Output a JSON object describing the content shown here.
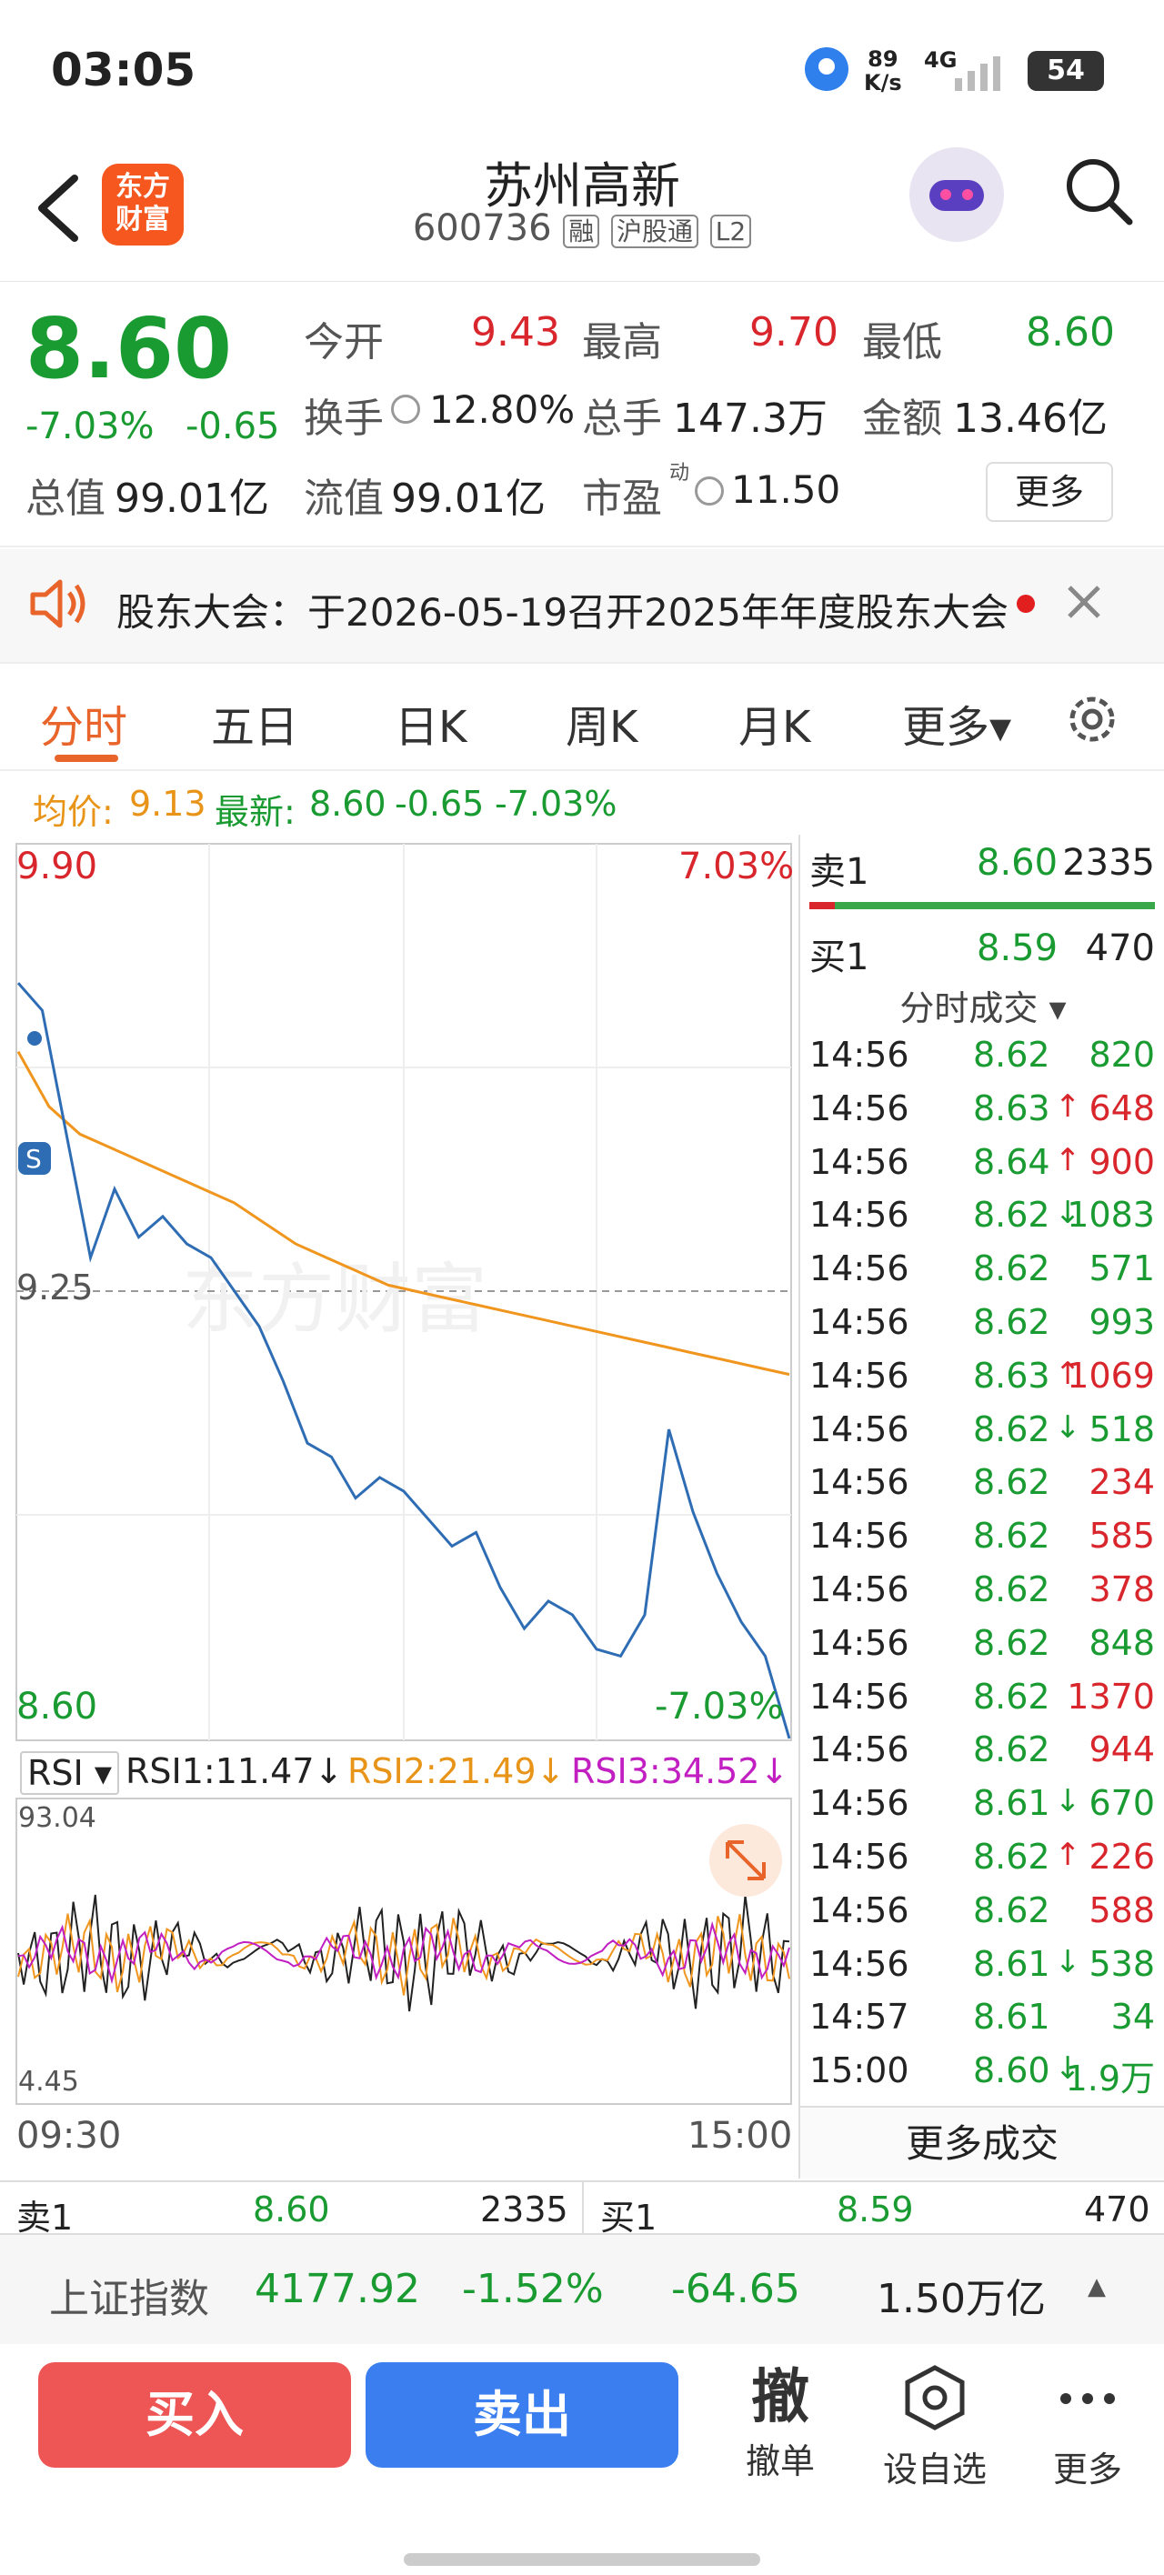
{
  "status": {
    "time": "03:05",
    "net_speed_top": "89",
    "net_speed_bottom": "K/s",
    "signal": "4G",
    "battery": "54"
  },
  "header": {
    "logo_line1": "东方",
    "logo_line2": "财富",
    "title": "苏州高新",
    "code": "600736",
    "tag1": "融",
    "tag2": "沪股通",
    "tag3": "L2"
  },
  "quote": {
    "price": "8.60",
    "change_pct": "-7.03%",
    "change_amt": "-0.65",
    "open_label": "今开",
    "open": "9.43",
    "high_label": "最高",
    "high": "9.70",
    "low_label": "最低",
    "low": "8.60",
    "turnover_label": "换手",
    "turnover": "12.80%",
    "volume_label": "总手",
    "volume": "147.3万",
    "amount_label": "金额",
    "amount": "13.46亿",
    "mktcap_label": "总值",
    "mktcap": "99.01亿",
    "float_label": "流值",
    "float": "99.01亿",
    "pe_label": "市盈",
    "pe_sup": "动",
    "pe": "11.50",
    "more_button": "更多"
  },
  "notice": {
    "text": "股东大会：于2026-05-19召开2025年年度股东大会"
  },
  "tabs": [
    "分时",
    "五日",
    "日K",
    "周K",
    "月K",
    "更多▾"
  ],
  "avg_line": {
    "avg_label": "均价:",
    "avg": "9.13",
    "latest_label": "最新:",
    "latest": "8.60",
    "chg": "-0.65",
    "pct": "-7.03%"
  },
  "chart": {
    "y_top": "9.90",
    "y_mid": "9.25",
    "y_bottom": "8.60",
    "pct_top": "7.03%",
    "pct_bottom": "-7.03%",
    "watermark": "东方财富",
    "s_marker": "S",
    "rsi_selector": "RSI",
    "rsi1": "RSI1:11.47↓",
    "rsi2": "RSI2:21.49↓",
    "rsi3": "RSI3:34.52↓",
    "rsi_top": "93.04",
    "rsi_bottom": "4.45",
    "time_start": "09:30",
    "time_end": "15:00",
    "price_color": "#2e6db4",
    "avg_color": "#f0961e"
  },
  "chart_data": {
    "type": "line",
    "x_range": [
      "09:30",
      "15:00"
    ],
    "ylim": [
      8.6,
      9.9
    ],
    "series": [
      {
        "values": [
          9.7,
          9.66,
          9.48,
          9.3,
          9.4,
          9.33,
          9.36,
          9.32,
          9.3,
          9.25,
          9.2,
          9.12,
          9.03,
          9.01,
          8.95,
          8.98,
          8.96,
          8.92,
          8.88,
          8.9,
          8.82,
          8.76,
          8.8,
          8.78,
          8.73,
          8.72,
          8.78,
          9.05,
          8.93,
          8.84,
          8.77,
          8.72,
          8.6
        ]
      },
      {
        "values": [
          9.6,
          9.52,
          9.48,
          9.46,
          9.44,
          9.42,
          9.4,
          9.38,
          9.35,
          9.32,
          9.3,
          9.28,
          9.26,
          9.25,
          9.24,
          9.23,
          9.22,
          9.21,
          9.2,
          9.19,
          9.18,
          9.17,
          9.16,
          9.15,
          9.14,
          9.13
        ]
      }
    ]
  },
  "orderbook": {
    "sell_label": "卖1",
    "sell_price": "8.60",
    "sell_vol": "2335",
    "buy_label": "买1",
    "buy_price": "8.59",
    "buy_vol": "470"
  },
  "ticks_header": "分时成交 ▾",
  "ticks": [
    {
      "t": "14:56",
      "p": "8.62",
      "a": "",
      "v": "820",
      "c": "g"
    },
    {
      "t": "14:56",
      "p": "8.63",
      "a": "↑",
      "v": "648",
      "c": "r"
    },
    {
      "t": "14:56",
      "p": "8.64",
      "a": "↑",
      "v": "900",
      "c": "r"
    },
    {
      "t": "14:56",
      "p": "8.62",
      "a": "↓",
      "v": "1083",
      "c": "g"
    },
    {
      "t": "14:56",
      "p": "8.62",
      "a": "",
      "v": "571",
      "c": "g"
    },
    {
      "t": "14:56",
      "p": "8.62",
      "a": "",
      "v": "993",
      "c": "g"
    },
    {
      "t": "14:56",
      "p": "8.63",
      "a": "↑",
      "v": "1069",
      "c": "r"
    },
    {
      "t": "14:56",
      "p": "8.62",
      "a": "↓",
      "v": "518",
      "c": "g"
    },
    {
      "t": "14:56",
      "p": "8.62",
      "a": "",
      "v": "234",
      "c": "r"
    },
    {
      "t": "14:56",
      "p": "8.62",
      "a": "",
      "v": "585",
      "c": "r"
    },
    {
      "t": "14:56",
      "p": "8.62",
      "a": "",
      "v": "378",
      "c": "r"
    },
    {
      "t": "14:56",
      "p": "8.62",
      "a": "",
      "v": "848",
      "c": "g"
    },
    {
      "t": "14:56",
      "p": "8.62",
      "a": "",
      "v": "1370",
      "c": "r"
    },
    {
      "t": "14:56",
      "p": "8.62",
      "a": "",
      "v": "944",
      "c": "r"
    },
    {
      "t": "14:56",
      "p": "8.61",
      "a": "↓",
      "v": "670",
      "c": "g"
    },
    {
      "t": "14:56",
      "p": "8.62",
      "a": "↑",
      "v": "226",
      "c": "r"
    },
    {
      "t": "14:56",
      "p": "8.62",
      "a": "",
      "v": "588",
      "c": "r"
    },
    {
      "t": "14:56",
      "p": "8.61",
      "a": "↓",
      "v": "538",
      "c": "g"
    },
    {
      "t": "14:57",
      "p": "8.61",
      "a": "",
      "v": "34",
      "c": "g"
    },
    {
      "t": "15:00",
      "p": "8.60",
      "a": "↓",
      "v": "1.9万",
      "c": "g"
    }
  ],
  "more_ticks": "更多成交",
  "index": {
    "name": "上证指数",
    "value": "4177.92",
    "pct": "-1.52%",
    "chg": "-64.65",
    "amount": "1.50万亿"
  },
  "actions": {
    "buy": "买入",
    "sell": "卖出",
    "cancel_glyph": "撤",
    "cancel": "撤单",
    "watch": "设自选",
    "more": "更多"
  }
}
